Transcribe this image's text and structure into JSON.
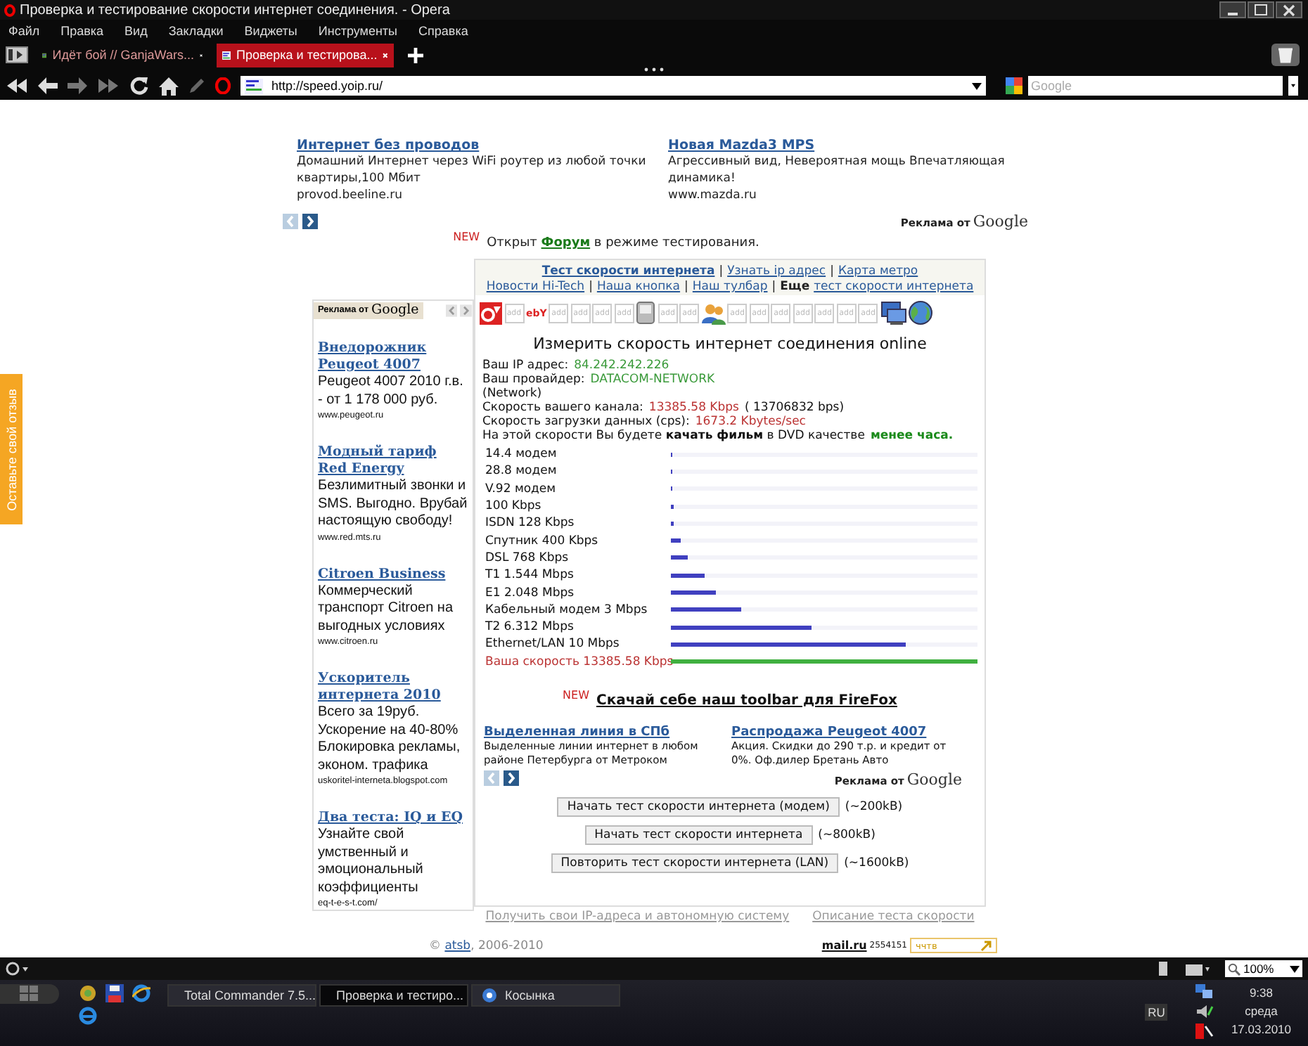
{
  "window": {
    "title": "Проверка и тестирование скорости интернет соединения. - Opera"
  },
  "menu": [
    "Файл",
    "Правка",
    "Вид",
    "Закладки",
    "Виджеты",
    "Инструменты",
    "Справка"
  ],
  "tabs": [
    {
      "label": "Идёт бой // GanjaWars...",
      "selected": false
    },
    {
      "label": "Проверка и тестирова...",
      "selected": true
    }
  ],
  "address_bar": {
    "url": "http://speed.yoip.ru/"
  },
  "search": {
    "placeholder": "Google"
  },
  "page": {
    "feedback_tab": "Оставьте свой отзыв",
    "top_ads": [
      {
        "title": "Интернет без проводов",
        "text": "Домашний Интернет через WiFi роутер из любой точки квартиры,100 Мбит",
        "url": "provod.beeline.ru"
      },
      {
        "title": "Новая Mazda3 MPS",
        "text": "Агрессивный вид, Невероятная мощь Впечатляющая динамика!",
        "url": "www.mazda.ru"
      }
    ],
    "ads_by": {
      "label": "Реклама от",
      "brand": "Google"
    },
    "news": {
      "badge": "NEW",
      "before": "Открыт",
      "link": "Форум",
      "after": "в режиме тестирования."
    },
    "side_ads_by": {
      "label": "Реклама от",
      "brand": "Google"
    },
    "side_ads": [
      {
        "title": "Внедорожник Peugeot 4007",
        "text": "Peugeot 4007 2010 г.в. - от 1 178 000 руб.",
        "url": "www.peugeot.ru"
      },
      {
        "title": "Модный тариф Red Energy",
        "text": "Безлимитный звонки и SMS. Выгодно. Врубай настоящую свободу!",
        "url": "www.red.mts.ru"
      },
      {
        "title": "Citroen Business",
        "text": "Коммерческий транспорт Citroen на выгодных условиях",
        "url": "www.citroen.ru"
      },
      {
        "title": "Ускоритель интернета 2010",
        "text": "Всего за 19руб. Ускорение на 40-80% Блокировка рекламы, эконом. трафика",
        "url": "uskoritel-interneta.blogspot.com"
      },
      {
        "title": "Два теста: IQ и EQ",
        "text": "Узнайте свой умственный и эмоциональный коэффициенты",
        "url": "eq-t-e-s-t.com/"
      }
    ],
    "nav_rows": [
      [
        {
          "kind": "link",
          "label": "Тест скорости интернета",
          "bold": true
        },
        {
          "kind": "sep",
          "label": "|"
        },
        {
          "kind": "link",
          "label": "Узнать ip адрес",
          "bold": false
        },
        {
          "kind": "sep",
          "label": "|"
        },
        {
          "kind": "link",
          "label": "Карта метро",
          "bold": false
        }
      ],
      [
        {
          "kind": "link",
          "label": "Новости Hi-Tech",
          "bold": false
        },
        {
          "kind": "sep",
          "label": "|"
        },
        {
          "kind": "link",
          "label": "Наша кнопка",
          "bold": false
        },
        {
          "kind": "sep",
          "label": "|"
        },
        {
          "kind": "link",
          "label": "Наш тулбар",
          "bold": false
        },
        {
          "kind": "sep",
          "label": "|"
        },
        {
          "kind": "text",
          "label": "Еще",
          "bold": true
        },
        {
          "kind": "link",
          "label": "тест скорости интернета",
          "bold": false
        }
      ]
    ],
    "icons": [
      {
        "kind": "logo"
      },
      {
        "kind": "add",
        "label": "add"
      },
      {
        "kind": "ebay",
        "label": "ebY"
      },
      {
        "kind": "add",
        "label": "add"
      },
      {
        "kind": "add",
        "label": "add"
      },
      {
        "kind": "add",
        "label": "add"
      },
      {
        "kind": "add",
        "label": "add"
      },
      {
        "kind": "device"
      },
      {
        "kind": "add",
        "label": "add"
      },
      {
        "kind": "add",
        "label": "add"
      },
      {
        "kind": "people"
      },
      {
        "kind": "add",
        "label": "add"
      },
      {
        "kind": "add",
        "label": "add"
      },
      {
        "kind": "add",
        "label": "add"
      },
      {
        "kind": "add",
        "label": "add"
      },
      {
        "kind": "add",
        "label": "add"
      },
      {
        "kind": "add",
        "label": "add"
      },
      {
        "kind": "add",
        "label": "add"
      },
      {
        "kind": "computer"
      },
      {
        "kind": "globe"
      }
    ],
    "heading": "Измерить скорость интернет соединения online",
    "info": [
      {
        "label": "Ваш IP адрес:",
        "value": "84.242.242.226",
        "color": "#3a9a3a",
        "bold": false
      },
      {
        "label": "Ваш провайдер:",
        "value": "DATACOM-NETWORK",
        "color": "#3a9a3a",
        "bold": false
      },
      {
        "label": "(Network)"
      },
      {
        "label": "Скорость вашего канала:",
        "value": "13385.58 Kbps",
        "color": "#bb3333",
        "bold": false,
        "suffix": "( 13706832 bps)"
      },
      {
        "label": "Скорость загрузки данных (cps):",
        "value": "1673.2 Kbytes/sec",
        "color": "#bb3333",
        "bold": false
      },
      {
        "label": "На этой скорости Вы будете **качать фильм** в DVD качестве",
        "value": "менее часа.",
        "color": "#1a8a1a",
        "bold": true
      }
    ],
    "speeds": [
      {
        "label": "14.4 модем",
        "level": 0.005,
        "kind": "reference"
      },
      {
        "label": "28.8 модем",
        "level": 0.005,
        "kind": "reference"
      },
      {
        "label": "V.92 модем",
        "level": 0.005,
        "kind": "reference"
      },
      {
        "label": "100 Kbps",
        "level": 0.007,
        "kind": "reference"
      },
      {
        "label": "ISDN 128 Kbps",
        "level": 0.01,
        "kind": "reference"
      },
      {
        "label": "Спутник 400 Kbps",
        "level": 0.03,
        "kind": "reference"
      },
      {
        "label": "DSL 768 Kbps",
        "level": 0.056,
        "kind": "reference"
      },
      {
        "label": "T1 1.544 Mbps",
        "level": 0.112,
        "kind": "reference"
      },
      {
        "label": "E1 2.048 Mbps",
        "level": 0.148,
        "kind": "reference"
      },
      {
        "label": "Кабельный модем 3 Mbps",
        "level": 0.228,
        "kind": "reference"
      },
      {
        "label": "T2 6.312 Mbps",
        "level": 0.458,
        "kind": "reference"
      },
      {
        "label": "Ethernet/LAN 10 Mbps",
        "level": 0.764,
        "kind": "reference"
      },
      {
        "label": "Ваша скорость 13385.58 Kbps",
        "level": 1,
        "kind": "yours"
      }
    ],
    "toolbar_promo": {
      "badge": "NEW",
      "link": "Скачай себе наш toolbar для FireFox"
    },
    "bottom_ads": [
      {
        "title": "Выделенная линия в СПб",
        "text": "Выделенные линии интернет в любом районе Петербурга от Метроком"
      },
      {
        "title": "Распродажа Peugeot 4007",
        "text": "Акция. Скидки до 290 т.р. и кредит от 0%. Оф.дилер Бретань Авто"
      }
    ],
    "bottom_ads_by": {
      "label": "Реклама от",
      "brand": "Google"
    },
    "tests": [
      {
        "button": "Начать тест скорости интернета (модем)",
        "size": "(~200kB)"
      },
      {
        "button": "Начать тест скорости интернета",
        "size": "(~800kB)"
      },
      {
        "button": "Повторить тест скорости интернета (LAN)",
        "size": "(~1600kB)"
      }
    ],
    "footer_links": [
      "Получить свои IP-адреса и автономную систему",
      "Описание теста скорости"
    ],
    "copyright": {
      "symbol": "©",
      "link": "atsb",
      "rest": ", 2006-2010"
    },
    "counter": {
      "logo": "mail.ru",
      "count": "2554151",
      "box": "ччтв"
    }
  },
  "status_bar": {
    "zoom": "100%"
  },
  "taskbar": {
    "tasks": [
      {
        "label": "Total Commander 7.5...",
        "selected": false
      },
      {
        "label": "Проверка и тестиро...",
        "selected": true
      },
      {
        "label": "Косынка",
        "selected": false
      }
    ],
    "lang": "RU",
    "time": "9:38",
    "day": "среда",
    "date": "17.03.2010"
  }
}
